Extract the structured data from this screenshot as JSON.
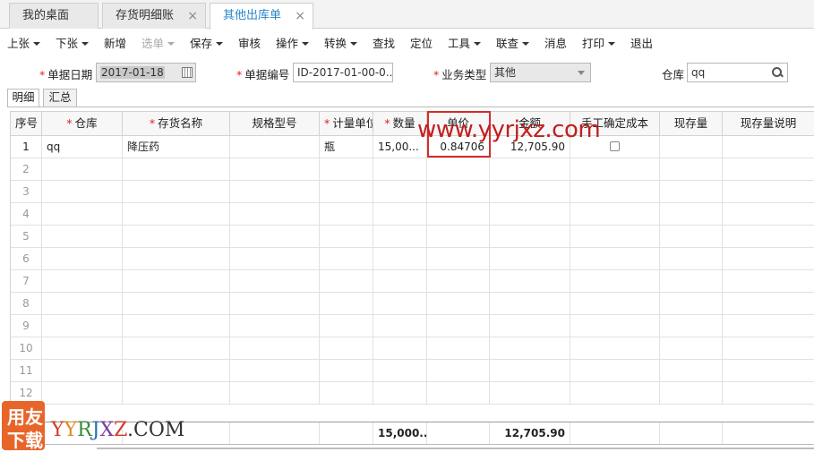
{
  "tabs": [
    {
      "label": "我的桌面",
      "active": false,
      "closable": false
    },
    {
      "label": "存货明细账",
      "active": false,
      "closable": true
    },
    {
      "label": "其他出库单",
      "active": true,
      "closable": true
    }
  ],
  "tab_close_glyph": "×",
  "toolbar": [
    {
      "label": "上张",
      "dropdown": true,
      "disabled": false
    },
    {
      "label": "下张",
      "dropdown": true,
      "disabled": false
    },
    {
      "label": "新增",
      "dropdown": false,
      "disabled": false
    },
    {
      "label": "选单",
      "dropdown": true,
      "disabled": true
    },
    {
      "label": "保存",
      "dropdown": true,
      "disabled": false
    },
    {
      "label": "审核",
      "dropdown": false,
      "disabled": false
    },
    {
      "label": "操作",
      "dropdown": true,
      "disabled": false
    },
    {
      "label": "转换",
      "dropdown": true,
      "disabled": false
    },
    {
      "label": "查找",
      "dropdown": false,
      "disabled": false
    },
    {
      "label": "定位",
      "dropdown": false,
      "disabled": false
    },
    {
      "label": "工具",
      "dropdown": true,
      "disabled": false
    },
    {
      "label": "联查",
      "dropdown": true,
      "disabled": false
    },
    {
      "label": "消息",
      "dropdown": false,
      "disabled": false
    },
    {
      "label": "打印",
      "dropdown": true,
      "disabled": false
    },
    {
      "label": "退出",
      "dropdown": false,
      "disabled": false
    }
  ],
  "form": {
    "required_mark": "*",
    "date_label": "单据日期",
    "date_value": "2017-01-18",
    "code_label": "单据编号",
    "code_value": "ID-2017-01-00-0...",
    "type_label": "业务类型",
    "type_value": "其他",
    "warehouse_label": "仓库",
    "warehouse_value": "qq"
  },
  "subtabs": [
    {
      "label": "明细",
      "active": true
    },
    {
      "label": "汇总",
      "active": false
    }
  ],
  "grid": {
    "columns": [
      {
        "label": "序号",
        "required": false
      },
      {
        "label": "仓库",
        "required": true
      },
      {
        "label": "存货名称",
        "required": true
      },
      {
        "label": "规格型号",
        "required": false
      },
      {
        "label": "计量单位",
        "required": true
      },
      {
        "label": "数量",
        "required": true
      },
      {
        "label": "单价",
        "required": false
      },
      {
        "label": "金额",
        "required": false
      },
      {
        "label": "手工确定成本",
        "required": false
      },
      {
        "label": "现存量",
        "required": false
      },
      {
        "label": "现存量说明",
        "required": false
      }
    ],
    "data_row": {
      "num": "1",
      "warehouse": "qq",
      "item": "降压药",
      "spec": "",
      "unit": "瓶",
      "qty": "15,00...",
      "price": "0.84706",
      "amount": "12,705.90",
      "manual_cost_checked": false,
      "stock": "",
      "stock_note": ""
    },
    "empty_row_numbers": [
      "2",
      "3",
      "4",
      "5",
      "6",
      "7",
      "8",
      "9",
      "10",
      "11",
      "12"
    ],
    "totals": {
      "qty": "15,000...",
      "amount": "12,705.90"
    }
  },
  "watermark": {
    "url": "www.yyrjxz.com",
    "logo_top": "用友",
    "logo_bottom": "下载",
    "brand_letters": [
      {
        "ch": "Y",
        "color": "#d23c2c"
      },
      {
        "ch": "Y",
        "color": "#e28a1f"
      },
      {
        "ch": "R",
        "color": "#3a8a3a"
      },
      {
        "ch": "J",
        "color": "#2a6fb5"
      },
      {
        "ch": "X",
        "color": "#7b3fa0"
      },
      {
        "ch": "Z",
        "color": "#d23c2c"
      },
      {
        "ch": ".COM",
        "color": "#333333"
      }
    ]
  }
}
